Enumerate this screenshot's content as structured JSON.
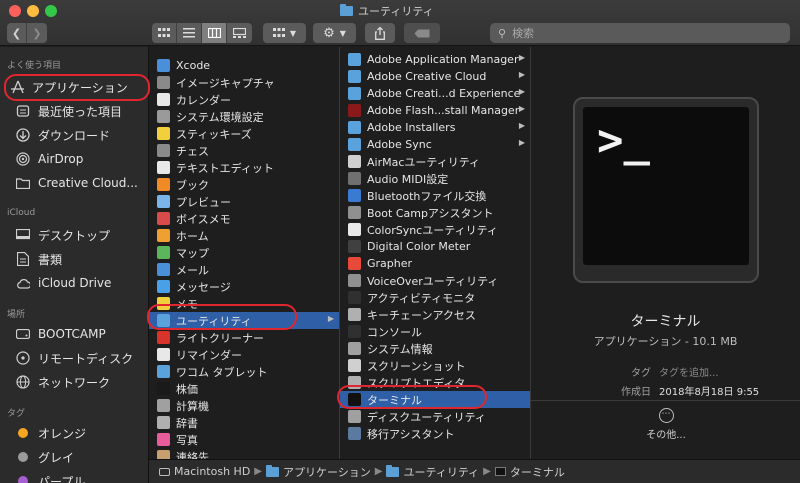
{
  "window": {
    "title": "ユーティリティ"
  },
  "toolbar": {
    "search_placeholder": "検索"
  },
  "sidebar": {
    "favorites_header": "よく使う項目",
    "favorites": [
      {
        "label": "アプリケーション",
        "icon": "apps-icon"
      },
      {
        "label": "最近使った項目",
        "icon": "recent-icon"
      },
      {
        "label": "ダウンロード",
        "icon": "download-icon"
      },
      {
        "label": "AirDrop",
        "icon": "airdrop-icon"
      },
      {
        "label": "Creative Cloud...",
        "icon": "folder-icon"
      }
    ],
    "icloud_header": "iCloud",
    "icloud": [
      {
        "label": "デスクトップ",
        "icon": "desktop-icon"
      },
      {
        "label": "書類",
        "icon": "document-icon"
      },
      {
        "label": "iCloud Drive",
        "icon": "cloud-icon"
      }
    ],
    "places_header": "場所",
    "places": [
      {
        "label": "BOOTCAMP",
        "icon": "disk-icon"
      },
      {
        "label": "リモートディスク",
        "icon": "disc-icon"
      },
      {
        "label": "ネットワーク",
        "icon": "network-icon"
      }
    ],
    "tags_header": "タグ",
    "tags": [
      {
        "label": "オレンジ",
        "color": "#f5a623"
      },
      {
        "label": "グレイ",
        "color": "#9b9b9b"
      },
      {
        "label": "パープル",
        "color": "#a55fd0"
      }
    ]
  },
  "applications_column": [
    "Xcode",
    "イメージキャプチャ",
    "カレンダー",
    "システム環境設定",
    "スティッキーズ",
    "チェス",
    "テキストエディット",
    "ブック",
    "プレビュー",
    "ボイスメモ",
    "ホーム",
    "マップ",
    "メール",
    "メッセージ",
    "メモ",
    "ユーティリティ",
    "ライトクリーナー",
    "リマインダー",
    "ワコム タブレット",
    "株価",
    "計算機",
    "辞書",
    "写真",
    "連絡先"
  ],
  "applications_selected": "ユーティリティ",
  "utilities_column": [
    "Adobe Application Manager",
    "Adobe Creative Cloud",
    "Adobe Creati...d Experience",
    "Adobe Flash...stall Manager",
    "Adobe Installers",
    "Adobe Sync",
    "AirMacユーティリティ",
    "Audio MIDI設定",
    "Bluetoothファイル交換",
    "Boot Campアシスタント",
    "ColorSyncユーティリティ",
    "Digital Color Meter",
    "Grapher",
    "VoiceOverユーティリティ",
    "アクティビティモニタ",
    "キーチェーンアクセス",
    "コンソール",
    "システム情報",
    "スクリーンショット",
    "スクリプトエディタ",
    "ターミナル",
    "ディスクユーティリティ",
    "移行アシスタント"
  ],
  "utilities_selected": "ターミナル",
  "preview": {
    "name": "ターミナル",
    "kind_size": "アプリケーション - 10.1 MB",
    "tag_label": "タグ",
    "tag_placeholder": "タグを追加...",
    "created_label": "作成日",
    "created_value": "2018年8月18日 9:55",
    "more_label": "その他...",
    "prompt": ">_"
  },
  "path": [
    "Macintosh HD",
    "アプリケーション",
    "ユーティリティ",
    "ターミナル"
  ]
}
